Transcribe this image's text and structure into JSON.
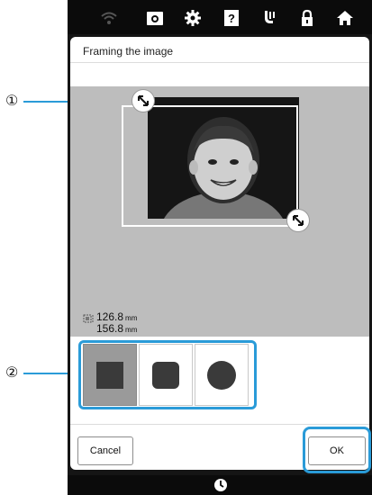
{
  "dialog": {
    "title": "Framing the image"
  },
  "frame_size": {
    "width_value": "126.8",
    "height_value": "156.8",
    "unit": "mm"
  },
  "shapes": [
    {
      "name": "square",
      "selected": true
    },
    {
      "name": "rounded-square",
      "selected": false
    },
    {
      "name": "circle",
      "selected": false
    }
  ],
  "buttons": {
    "cancel": "Cancel",
    "ok": "OK"
  },
  "callouts": {
    "one": "①",
    "two": "②"
  },
  "topbar_icons": [
    "wifi-icon",
    "camera-icon",
    "gear-icon",
    "help-icon",
    "needle-icon",
    "lock-icon",
    "home-icon"
  ],
  "colors": {
    "highlight": "#2a9bd8",
    "preview_bg": "#bdbdbd",
    "selected_shape_bg": "#9a9a9a",
    "shape_fill": "#3a3a3a"
  }
}
